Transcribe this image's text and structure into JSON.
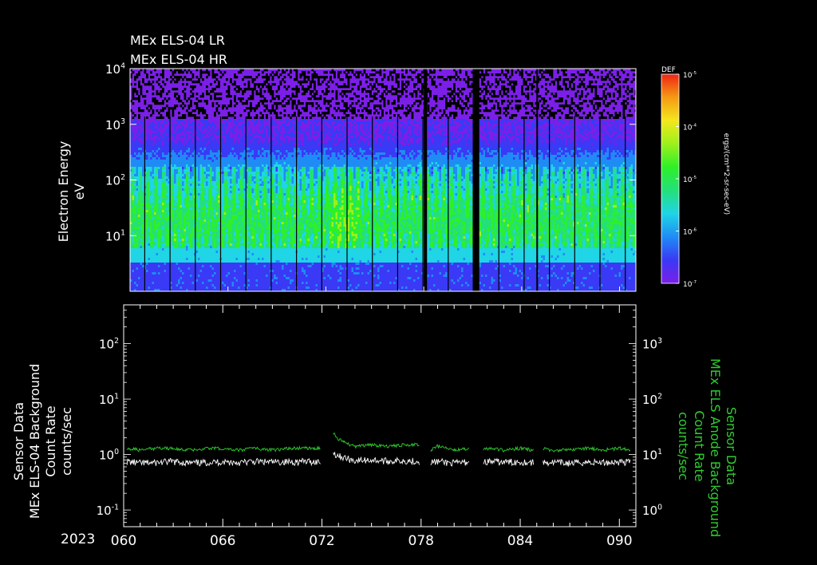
{
  "header": {
    "line1": "MEx ELS-04 LR",
    "line2": "MEx ELS-04 HR"
  },
  "colors": {
    "background": "#000000",
    "axis": "#ffffff",
    "series_primary": "#ffffff",
    "series_secondary": "#2ecc2e",
    "data_gap": "#000000"
  },
  "chart_data": [
    {
      "type": "heatmap",
      "ylabel_line1": "Electron Energy",
      "ylabel_line2": "eV",
      "y_scale": "log",
      "y_tick_labels": [
        {
          "base": "10",
          "exp": "4",
          "value": 10000
        },
        {
          "base": "10",
          "exp": "3",
          "value": 1000
        },
        {
          "base": "10",
          "exp": "2",
          "value": 100
        },
        {
          "base": "10",
          "exp": "1",
          "value": 10
        }
      ],
      "ylim": [
        1,
        10000
      ],
      "xlim": [
        60,
        91
      ],
      "data_gaps": [
        [
          78.0,
          78.2
        ],
        [
          81.0,
          81.4
        ],
        [
          84.9,
          85.0
        ]
      ],
      "colorbar": {
        "title": "DEF",
        "label": "ergs/(cm**2-sr-sec-eV)",
        "scale": "log",
        "ticks": [
          {
            "base": "10",
            "exp": "-5",
            "value": 1e-05
          },
          {
            "base": "10",
            "exp": "-4",
            "value": 0.0001
          },
          {
            "base": "10",
            "exp": "-5",
            "value": 1e-05
          },
          {
            "base": "10",
            "exp": "-6",
            "value": 1e-06
          },
          {
            "base": "10",
            "exp": "-7",
            "value": 1e-07
          }
        ],
        "stops": [
          "#7b1fe8",
          "#3a39f5",
          "#1f8cf5",
          "#1fd5e6",
          "#23e07a",
          "#2ef028",
          "#9cf01c",
          "#f4e81c",
          "#f59a14",
          "#f02414"
        ]
      }
    },
    {
      "type": "line",
      "ylabel_left": [
        "Sensor Data",
        "MEx ELS-04 Background",
        "Count Rate",
        "counts/sec"
      ],
      "ylabel_right": [
        "Sensor Data",
        "MEx ELS Anode Background",
        "Count Rate",
        "counts/sec"
      ],
      "y_scale": "log",
      "ylim_left": [
        0.05,
        500
      ],
      "ylim_right": [
        0.5,
        5000
      ],
      "y_tick_labels_left": [
        {
          "base": "10",
          "exp": "2",
          "value": 100
        },
        {
          "base": "10",
          "exp": "1",
          "value": 10
        },
        {
          "base": "10",
          "exp": "0",
          "value": 1
        },
        {
          "base": "10",
          "exp": "-1",
          "value": 0.1
        }
      ],
      "y_tick_labels_right": [
        {
          "base": "10",
          "exp": "3",
          "value": 1000
        },
        {
          "base": "10",
          "exp": "2",
          "value": 100
        },
        {
          "base": "10",
          "exp": "1",
          "value": 10
        },
        {
          "base": "10",
          "exp": "0",
          "value": 1
        }
      ],
      "year_label": "2023",
      "x_ticks": [
        {
          "label": "060",
          "value": 60
        },
        {
          "label": "066",
          "value": 66
        },
        {
          "label": "072",
          "value": 72
        },
        {
          "label": "078",
          "value": 78
        },
        {
          "label": "084",
          "value": 84
        },
        {
          "label": "090",
          "value": 90
        }
      ],
      "xlim": [
        60,
        91
      ],
      "series": [
        {
          "axis": "left",
          "x": [
            60.2,
            61.0,
            62.0,
            63.0,
            64.0,
            65.0,
            66.0,
            67.0,
            68.0,
            69.0,
            70.0,
            71.0,
            72.0,
            72.5,
            73.0,
            73.5,
            74.0,
            75.0,
            76.0,
            77.0,
            77.8,
            78.4,
            79.0,
            80.0,
            80.9,
            81.6,
            82.0,
            83.0,
            84.0,
            84.8,
            85.2,
            86.0,
            87.0,
            88.0,
            89.0,
            90.0,
            90.7
          ],
          "values": [
            0.75,
            0.7,
            0.72,
            0.75,
            0.7,
            0.72,
            0.74,
            0.72,
            0.75,
            0.73,
            0.74,
            0.75,
            0.74,
            1.15,
            0.95,
            0.85,
            0.78,
            0.8,
            0.76,
            0.78,
            0.76,
            0.72,
            0.75,
            0.7,
            0.74,
            0.72,
            0.75,
            0.73,
            0.74,
            0.72,
            0.73,
            0.72,
            0.7,
            0.73,
            0.72,
            0.74,
            0.73
          ]
        },
        {
          "axis": "right",
          "x": [
            60.2,
            61.0,
            62.0,
            63.0,
            64.0,
            65.0,
            66.0,
            67.0,
            68.0,
            69.0,
            70.0,
            71.0,
            72.0,
            72.5,
            73.0,
            73.5,
            74.0,
            75.0,
            76.0,
            77.0,
            77.8,
            78.4,
            79.0,
            80.0,
            80.9,
            81.6,
            82.0,
            83.0,
            84.0,
            84.8,
            85.2,
            86.0,
            87.0,
            88.0,
            89.0,
            90.0,
            90.7
          ],
          "values": [
            13,
            12,
            13,
            13,
            12,
            13,
            13,
            12,
            13,
            12,
            13,
            13,
            13,
            27,
            19,
            16,
            14,
            15,
            14,
            15,
            15,
            11,
            14,
            12,
            13,
            12,
            13,
            12,
            13,
            12,
            13,
            12,
            12,
            13,
            12,
            13,
            12
          ]
        }
      ]
    }
  ]
}
